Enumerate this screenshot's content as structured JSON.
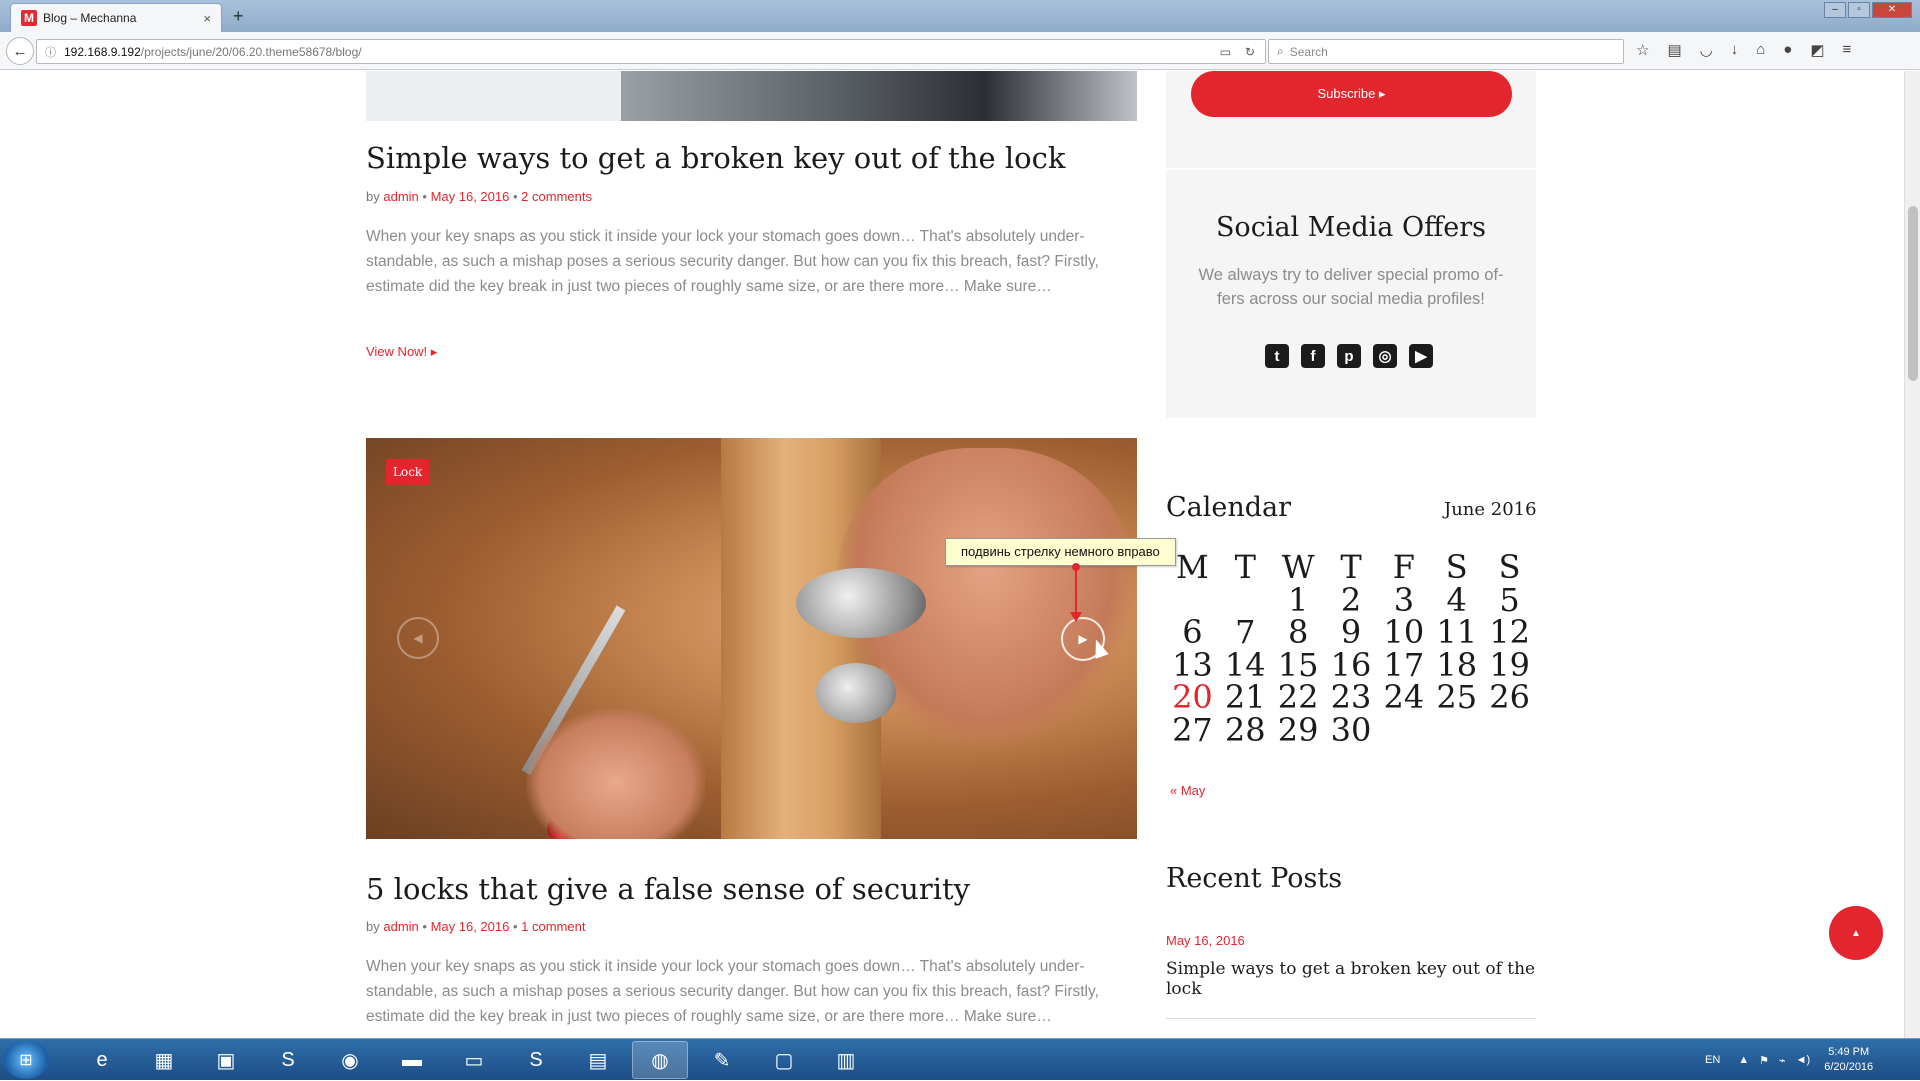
{
  "browser": {
    "tab_title": "Blog – Mechanna",
    "tab_favicon": "M",
    "tab_close": "×",
    "new_tab": "+",
    "url_host": "192.168.9.192",
    "url_path": "/projects/june/20/06.20.theme58678/blog/",
    "search_placeholder": "Search"
  },
  "posts": [
    {
      "title": "Simple ways to get a broken key out of the lock",
      "meta_by": "by",
      "author": "admin",
      "date": "May 16, 2016",
      "comments": "2 comments",
      "excerpt": "When your key snaps as you stick it inside your lock your stomach goes down… That's absolutely under-standable, as such a mishap poses a serious security danger. But how can you fix this breach, fast? Firstly, estimate did the key break in just two pieces of roughly same size, or are there more… Make sure…",
      "view_now": "View Now! ▸"
    },
    {
      "tag": "Lock",
      "title": "5 locks that give a false sense of security",
      "meta_by": "by",
      "author": "admin",
      "date": "May 16, 2016",
      "comments": "1 comment",
      "excerpt": "When your key snaps as you stick it inside your lock your stomach goes down… That's absolutely under-standable, as such a mishap poses a serious security danger. But how can you fix this breach, fast? Firstly, estimate did the key break in just two pieces of roughly same size, or are there more… Make sure…"
    }
  ],
  "annotation": {
    "tooltip": "подвинь стрелку немного вправо"
  },
  "sidebar": {
    "subscribe_label": "Subscribe ▸",
    "social_title": "Social Media Offers",
    "social_text": "We always try to deliver special promo of-fers across our social media profiles!",
    "social_icons": [
      "twitter-icon",
      "facebook-icon",
      "pinterest-icon",
      "instagram-icon",
      "youtube-icon"
    ],
    "calendar_title": "Calendar",
    "calendar_month": "June 2016",
    "calendar_headers": [
      "M",
      "T",
      "W",
      "T",
      "F",
      "S",
      "S"
    ],
    "calendar_weeks": [
      [
        "",
        "",
        "1",
        "2",
        "3",
        "4",
        "5"
      ],
      [
        "6",
        "7",
        "8",
        "9",
        "10",
        "11",
        "12"
      ],
      [
        "13",
        "14",
        "15",
        "16",
        "17",
        "18",
        "19"
      ],
      [
        "20",
        "21",
        "22",
        "23",
        "24",
        "25",
        "26"
      ],
      [
        "27",
        "28",
        "29",
        "30",
        "",
        "",
        ""
      ]
    ],
    "calendar_today": "20",
    "calendar_prev": "« May",
    "recent_title": "Recent Posts",
    "recent_date": "May 16, 2016",
    "recent_link": "Simple ways to get a broken key out of the lock"
  },
  "taskbar": {
    "lang": "EN",
    "time": "5:49 PM",
    "date": "6/20/2016"
  },
  "colors": {
    "accent": "#e3262e",
    "heading": "#1b1b1b",
    "body_text": "#8b8b8b"
  }
}
